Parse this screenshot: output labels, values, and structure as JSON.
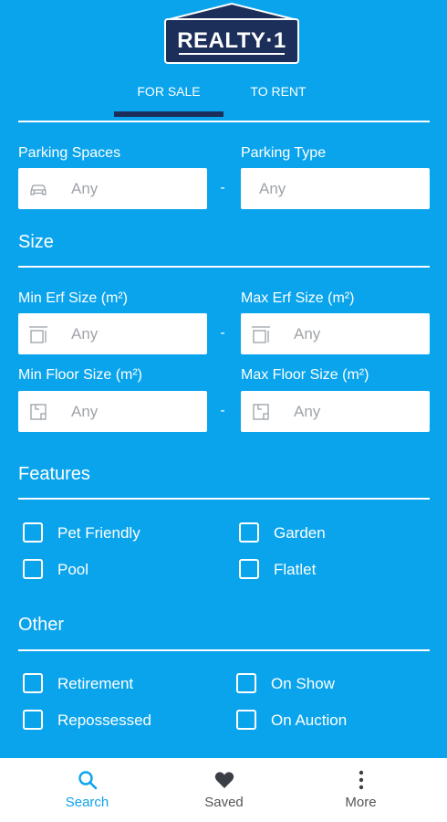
{
  "brand": {
    "logo_text": "REALTY·1",
    "logo_color": "#1C2F5A"
  },
  "colors": {
    "accent": "#0AA4EC",
    "dark": "#1C2F5A"
  },
  "tabs": [
    {
      "label": "FOR SALE",
      "active": true
    },
    {
      "label": "TO RENT",
      "active": false
    }
  ],
  "parking": {
    "spaces_label": "Parking Spaces",
    "spaces_value": "Any",
    "type_label": "Parking Type",
    "type_value": "Any",
    "separator": "-"
  },
  "size": {
    "title": "Size",
    "min_erf_label": "Min Erf Size (m²)",
    "min_erf_value": "Any",
    "max_erf_label": "Max Erf Size (m²)",
    "max_erf_value": "Any",
    "min_floor_label": "Min Floor Size (m²)",
    "min_floor_value": "Any",
    "max_floor_label": "Max Floor Size (m²)",
    "max_floor_value": "Any",
    "separator": "-"
  },
  "features": {
    "title": "Features",
    "items": [
      "Pet Friendly",
      "Garden",
      "Pool",
      "Flatlet"
    ]
  },
  "other": {
    "title": "Other",
    "items": [
      "Retirement",
      "On Show",
      "Repossessed",
      "On Auction"
    ]
  },
  "bottom_nav": [
    {
      "label": "Search",
      "icon": "search-icon",
      "active": true
    },
    {
      "label": "Saved",
      "icon": "heart-icon",
      "active": false
    },
    {
      "label": "More",
      "icon": "more-vertical-icon",
      "active": false
    }
  ]
}
